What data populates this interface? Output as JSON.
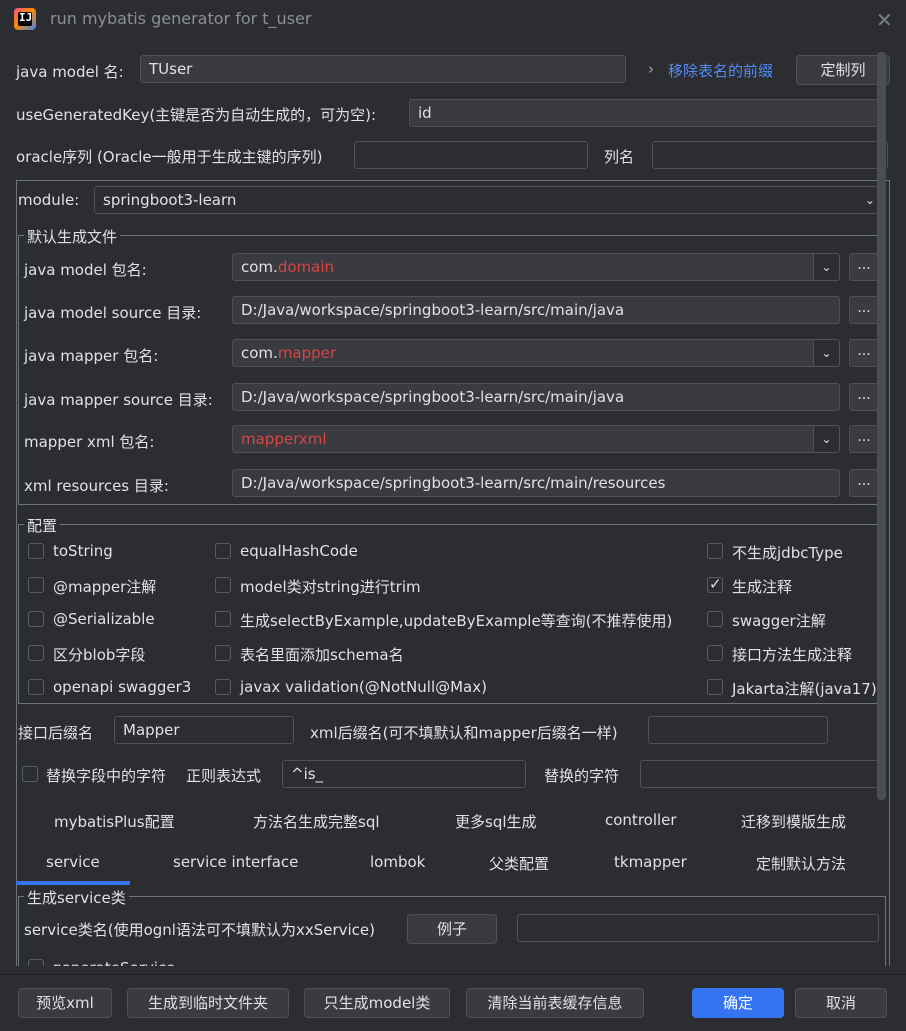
{
  "window": {
    "title": "run mybatis generator for t_user"
  },
  "top": {
    "model_label": "java model 名:",
    "model_value": "TUser",
    "remove_prefix_link": "移除表名的前缀",
    "custom_columns_btn": "定制列",
    "use_key_label": "useGeneratedKey(主键是否为自动生成的，可为空):",
    "use_key_value": "id",
    "oracle_label": "oracle序列 (Oracle一般用于生成主键的序列)",
    "oracle_value": "",
    "column_label": "列名",
    "column_value": ""
  },
  "module": {
    "label": "module:",
    "value": "springboot3-learn"
  },
  "default_files": {
    "title": "默认生成文件",
    "rows": [
      {
        "label": "java model 包名:",
        "prefix": "com.",
        "red": "domain",
        "type": "dropdown"
      },
      {
        "label": "java model source 目录:",
        "value": "D:/Java/workspace/springboot3-learn/src/main/java",
        "type": "text"
      },
      {
        "label": "java mapper 包名:",
        "prefix": "com.",
        "red": "mapper",
        "type": "dropdown"
      },
      {
        "label": "java mapper source 目录:",
        "value": "D:/Java/workspace/springboot3-learn/src/main/java",
        "type": "text"
      },
      {
        "label": "mapper xml 包名:",
        "prefix": "",
        "red": "mapperxml",
        "type": "dropdown"
      },
      {
        "label": "xml resources 目录:",
        "value": "D:/Java/workspace/springboot3-learn/src/main/resources",
        "type": "text"
      }
    ],
    "browse_label": "..."
  },
  "config": {
    "title": "配置",
    "col1": [
      {
        "label": "toString",
        "checked": false
      },
      {
        "label": "@mapper注解",
        "checked": false
      },
      {
        "label": "@Serializable",
        "checked": false
      },
      {
        "label": "区分blob字段",
        "checked": false
      },
      {
        "label": "openapi swagger3",
        "checked": false
      }
    ],
    "col2": [
      {
        "label": "equalHashCode",
        "checked": false
      },
      {
        "label": "model类对string进行trim",
        "checked": false
      },
      {
        "label": "生成selectByExample,updateByExample等查询(不推荐使用)",
        "checked": false
      },
      {
        "label": "表名里面添加schema名",
        "checked": false
      },
      {
        "label": "javax validation(@NotNull@Max)",
        "checked": false
      }
    ],
    "col3": [
      {
        "label": "不生成jdbcType",
        "checked": false
      },
      {
        "label": "生成注释",
        "checked": true
      },
      {
        "label": "swagger注解",
        "checked": false
      },
      {
        "label": "接口方法生成注释",
        "checked": false
      },
      {
        "label": "Jakarta注解(java17)",
        "checked": false
      }
    ]
  },
  "suffix": {
    "interface_label": "接口后缀名",
    "interface_value": "Mapper",
    "xml_label": "xml后缀名(可不填默认和mapper后缀名一样)",
    "xml_value": ""
  },
  "replace": {
    "label": "替换字段中的字符",
    "checked": false,
    "regex_label": "正则表达式",
    "regex_value": "^is_",
    "replace_label": "替换的字符",
    "replace_value": ""
  },
  "tabs_row1": [
    "mybatisPlus配置",
    "方法名生成完整sql",
    "更多sql生成",
    "controller",
    "迁移到模版生成"
  ],
  "tabs_row2": [
    "service",
    "service interface",
    "lombok",
    "父类配置",
    "tkmapper",
    "定制默认方法"
  ],
  "service": {
    "title": "生成service类",
    "name_label": "service类名(使用ognl语法可不填默认为xxService)",
    "example_btn": "例子",
    "name_value": "",
    "generate_label": "generateService",
    "generate_checked": false
  },
  "footer": {
    "preview": "预览xml",
    "temp": "生成到临时文件夹",
    "model_only": "只生成model类",
    "clear_cache": "清除当前表缓存信息",
    "ok": "确定",
    "cancel": "取消"
  }
}
